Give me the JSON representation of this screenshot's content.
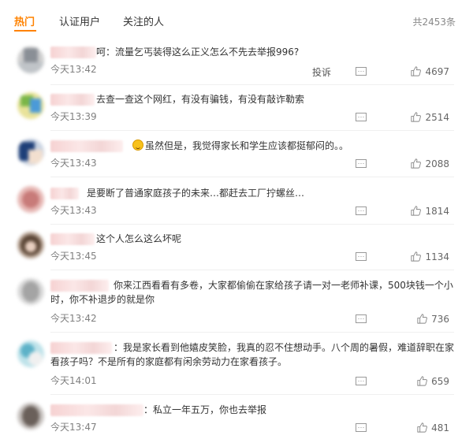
{
  "tabs": [
    {
      "label": "热门",
      "active": true
    },
    {
      "label": "认证用户",
      "active": false
    },
    {
      "label": "关注的人",
      "active": false
    }
  ],
  "total": "共2453条",
  "report_label": "投诉",
  "comments": [
    {
      "prefix": "呵：",
      "text": "流量乞丐装得这么正义怎么不先去举报996?",
      "time": "今天13:42",
      "likes": "4697"
    },
    {
      "prefix": "",
      "text": "去查一查这个网红，有没有骗钱，有没有敲诈勒索",
      "time": "今天13:39",
      "likes": "2514"
    },
    {
      "prefix": "",
      "text": "虽然但是，我觉得家长和学生应该都挺郁闷的。。",
      "time": "今天13:43",
      "likes": "2088"
    },
    {
      "prefix": "",
      "text": "是要断了普通家庭孩子的未来…都赶去工厂拧螺丝…",
      "time": "今天13:43",
      "likes": "1814"
    },
    {
      "prefix": "",
      "text": "这个人怎么这么坏呢",
      "time": "今天13:45",
      "likes": "1134"
    },
    {
      "prefix": "",
      "text": "你来江西看看有多卷，大家都偷偷在家给孩子请一对一老师补课，500块钱一个小时，你不补退步的就是你",
      "time": "今天13:42",
      "likes": "736"
    },
    {
      "prefix": "：",
      "text": "我是家长看到他嬉皮笑脸，我真的忍不住想动手。八个周的暑假，难道辞职在家看孩子吗？不是所有的家庭都有闲余劳动力在家看孩子。",
      "time": "今天14:01",
      "likes": "659"
    },
    {
      "prefix": "：",
      "text": "私立一年五万，你也去举报",
      "time": "今天13:47",
      "likes": "481"
    }
  ]
}
